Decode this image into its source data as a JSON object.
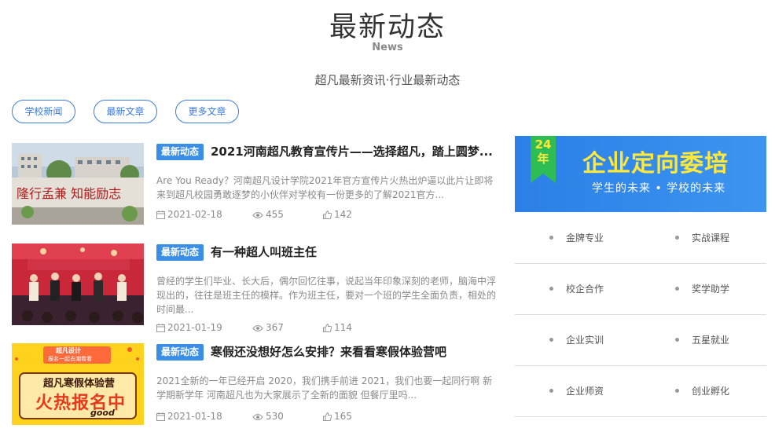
{
  "header": {
    "title": "最新动态",
    "subtitle": "News",
    "description": "超凡最新资讯·行业最新动态"
  },
  "tabs": [
    {
      "label": "学校新闻"
    },
    {
      "label": "最新文章"
    },
    {
      "label": "更多文章"
    }
  ],
  "articles": [
    {
      "badge": "最新动态",
      "title": "2021河南超凡教育宣传片——选择超凡，踏上圆梦...",
      "desc": "Are You Ready？河南超凡设计学院2021年官方宣传片火热出炉逼以此片让即将来到超凡校园勇敢逐梦的小伙伴对学校有一份更多的了解2021官方...",
      "date": "2021-02-18",
      "views": "455",
      "likes": "142",
      "image": "campus-gate-photo"
    },
    {
      "badge": "最新动态",
      "title": "有一种超人叫班主任",
      "desc": "曾经的学生们毕业、长大后，偶尔回忆往事，说起当年印象深刻的老师，脑海中浮现出的，往往是班主任的模样。作为班主任，要对一个班的学生全面负责，相处的时间最...",
      "date": "2021-01-19",
      "views": "367",
      "likes": "114",
      "image": "stage-ceremony-photo"
    },
    {
      "badge": "最新动态",
      "title": "寒假还没想好怎么安排？来看看寒假体验营吧",
      "desc": "2021全新的一年已经开启 2020，我们携手前进 2021，我们也要一起同行啊 新学期新学年 河南超凡也为大家展示了全新的面貌 但餐厅里吗...",
      "date": "2021-01-18",
      "views": "530",
      "likes": "165",
      "image": "winter-camp-poster",
      "poster": {
        "tag1": "超凡设计",
        "tag2": "报名一起去潮看看",
        "line1": "超凡寒假体验营",
        "line2": "火热报名中",
        "line3": "good"
      }
    }
  ],
  "banner": {
    "ribbon": "24年",
    "title": "企业定向委培",
    "subtitle": "学生的未来 • 学校的未来"
  },
  "side_links": [
    [
      "金牌专业",
      "实战课程"
    ],
    [
      "校企合作",
      "奖学助学"
    ],
    [
      "企业实训",
      "五星就业"
    ],
    [
      "企业师资",
      "创业孵化"
    ]
  ],
  "colors": {
    "accent": "#3a8ee6",
    "banner_title": "#ffe83a",
    "text_muted": "#8a8a8a"
  }
}
